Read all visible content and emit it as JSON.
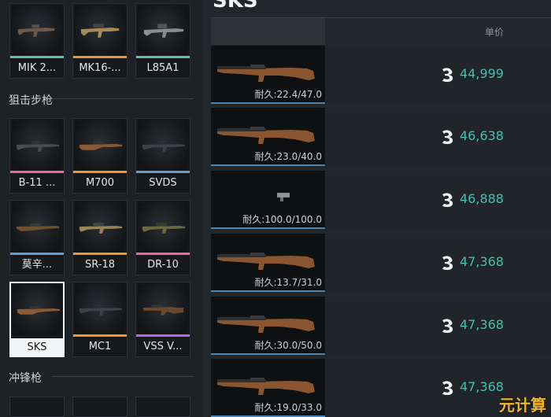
{
  "item": {
    "title": "SKS"
  },
  "header": {
    "unit_price_label": "单价"
  },
  "categories": [
    {
      "label": "",
      "weapons": [
        {
          "name": "MIK 2...",
          "accent": "#58c3a5",
          "selected": false
        },
        {
          "name": "MK16-...",
          "accent": "#e59a2f",
          "selected": false
        },
        {
          "name": "L85A1",
          "accent": "#58c3a5",
          "selected": false
        }
      ]
    },
    {
      "label": "狙击步枪",
      "weapons": [
        {
          "name": "B-11 ...",
          "accent": "#e86a9a",
          "selected": false
        },
        {
          "name": "M700",
          "accent": "#e59a2f",
          "selected": false
        },
        {
          "name": "SVDS",
          "accent": "#5a9fd6",
          "selected": false
        },
        {
          "name": "莫辛...",
          "accent": "#5a9fd6",
          "selected": false
        },
        {
          "name": "SR-18",
          "accent": "#e59a2f",
          "selected": false
        },
        {
          "name": "DR-10",
          "accent": "#e86a9a",
          "selected": false
        },
        {
          "name": "SKS",
          "accent": "#ffffff",
          "selected": true
        },
        {
          "name": "MC1",
          "accent": "#e59a2f",
          "selected": false
        },
        {
          "name": "VSS V...",
          "accent": "#b56be0",
          "selected": false
        }
      ]
    },
    {
      "label": "冲锋枪",
      "weapons": []
    }
  ],
  "listings": [
    {
      "durability": "耐久:22.4/47.0",
      "price": "44,999"
    },
    {
      "durability": "耐久:23.0/40.0",
      "price": "46,638"
    },
    {
      "durability": "耐久:100.0/100.0",
      "price": "46,888"
    },
    {
      "durability": "耐久:13.7/31.0",
      "price": "47,368"
    },
    {
      "durability": "耐久:30.0/50.0",
      "price": "47,368"
    },
    {
      "durability": "耐久:19.0/33.0",
      "price": "47,368"
    }
  ],
  "icons": {
    "currency": "havoc-coin-icon"
  },
  "colors": {
    "price": "#3fc3b0",
    "accent_blue": "#4a86b8"
  },
  "watermark": "元计算"
}
